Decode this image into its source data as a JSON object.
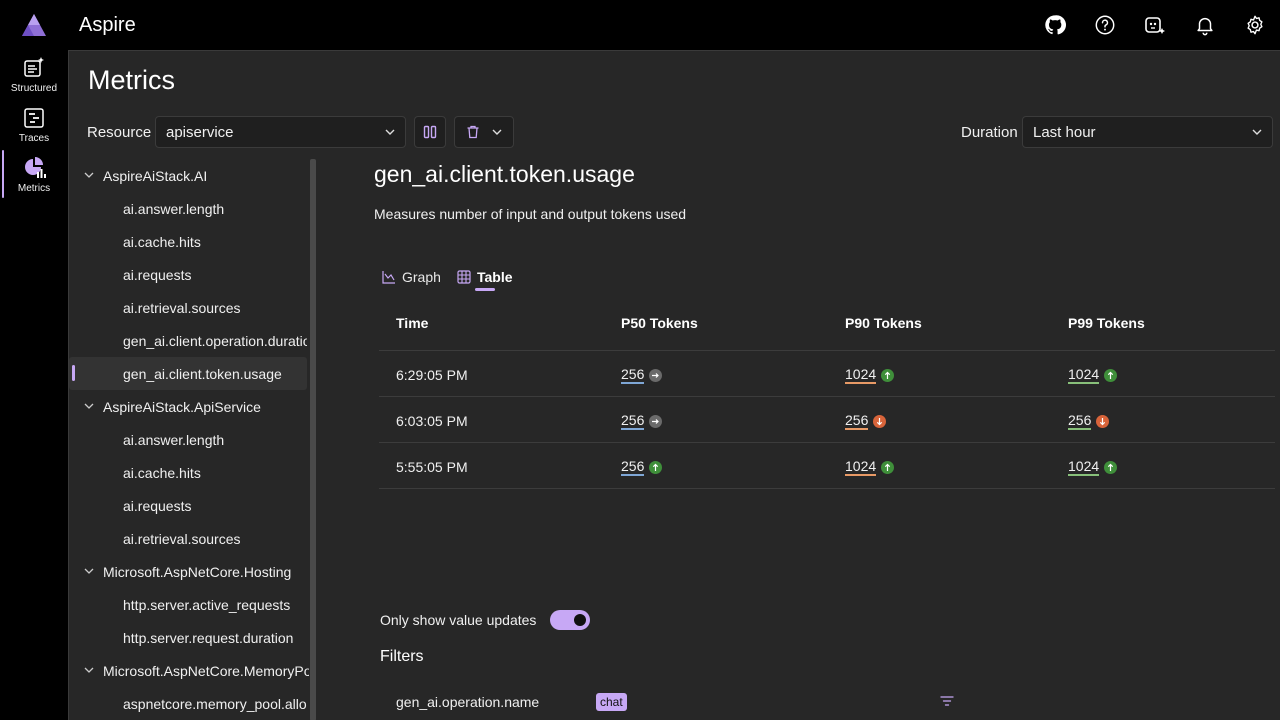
{
  "app": {
    "title": "Aspire"
  },
  "header_icons": [
    "github-icon",
    "help-icon",
    "copilot-icon",
    "bell-icon",
    "gear-icon"
  ],
  "rail": {
    "items": [
      {
        "label": "Structured",
        "icon": "structured-logs-icon"
      },
      {
        "label": "Traces",
        "icon": "traces-icon"
      },
      {
        "label": "Metrics",
        "icon": "metrics-icon",
        "active": true
      }
    ]
  },
  "page": {
    "title": "Metrics"
  },
  "toolbar": {
    "resource_label": "Resource",
    "resource_value": "apiservice",
    "duration_label": "Duration",
    "duration_value": "Last hour"
  },
  "tree": {
    "groups": [
      {
        "name": "AspireAiStack.AI",
        "items": [
          "ai.answer.length",
          "ai.cache.hits",
          "ai.requests",
          "ai.retrieval.sources",
          "gen_ai.client.operation.duration",
          "gen_ai.client.token.usage"
        ]
      },
      {
        "name": "AspireAiStack.ApiService",
        "items": [
          "ai.answer.length",
          "ai.cache.hits",
          "ai.requests",
          "ai.retrieval.sources"
        ]
      },
      {
        "name": "Microsoft.AspNetCore.Hosting",
        "items": [
          "http.server.active_requests",
          "http.server.request.duration"
        ]
      },
      {
        "name": "Microsoft.AspNetCore.MemoryPool",
        "items": [
          "aspnetcore.memory_pool.allocated"
        ]
      }
    ],
    "selected": "gen_ai.client.token.usage"
  },
  "metric": {
    "title": "gen_ai.client.token.usage",
    "description": "Measures number of input and output tokens used"
  },
  "tabs": [
    {
      "label": "Graph",
      "icon": "chart-icon"
    },
    {
      "label": "Table",
      "icon": "table-icon",
      "active": true
    }
  ],
  "table": {
    "headers": [
      "Time",
      "P50 Tokens",
      "P90 Tokens",
      "P99 Tokens"
    ],
    "rows": [
      {
        "time": "6:29:05 PM",
        "p50": "256",
        "p50_trend": "flat",
        "p90": "1024",
        "p90_trend": "up",
        "p99": "1024",
        "p99_trend": "up"
      },
      {
        "time": "6:03:05 PM",
        "p50": "256",
        "p50_trend": "flat",
        "p90": "256",
        "p90_trend": "down",
        "p99": "256",
        "p99_trend": "down"
      },
      {
        "time": "5:55:05 PM",
        "p50": "256",
        "p50_trend": "up",
        "p90": "1024",
        "p90_trend": "up",
        "p99": "1024",
        "p99_trend": "up"
      }
    ]
  },
  "toggle": {
    "label": "Only show value updates",
    "on": true
  },
  "filters": {
    "title": "Filters",
    "items": [
      {
        "name": "gen_ai.operation.name",
        "value": "chat"
      }
    ]
  },
  "colors": {
    "accent": "#c7a8f5",
    "trend_up": "#3f8f3a",
    "trend_down": "#d8643a",
    "trend_flat": "#6a6a6a"
  }
}
